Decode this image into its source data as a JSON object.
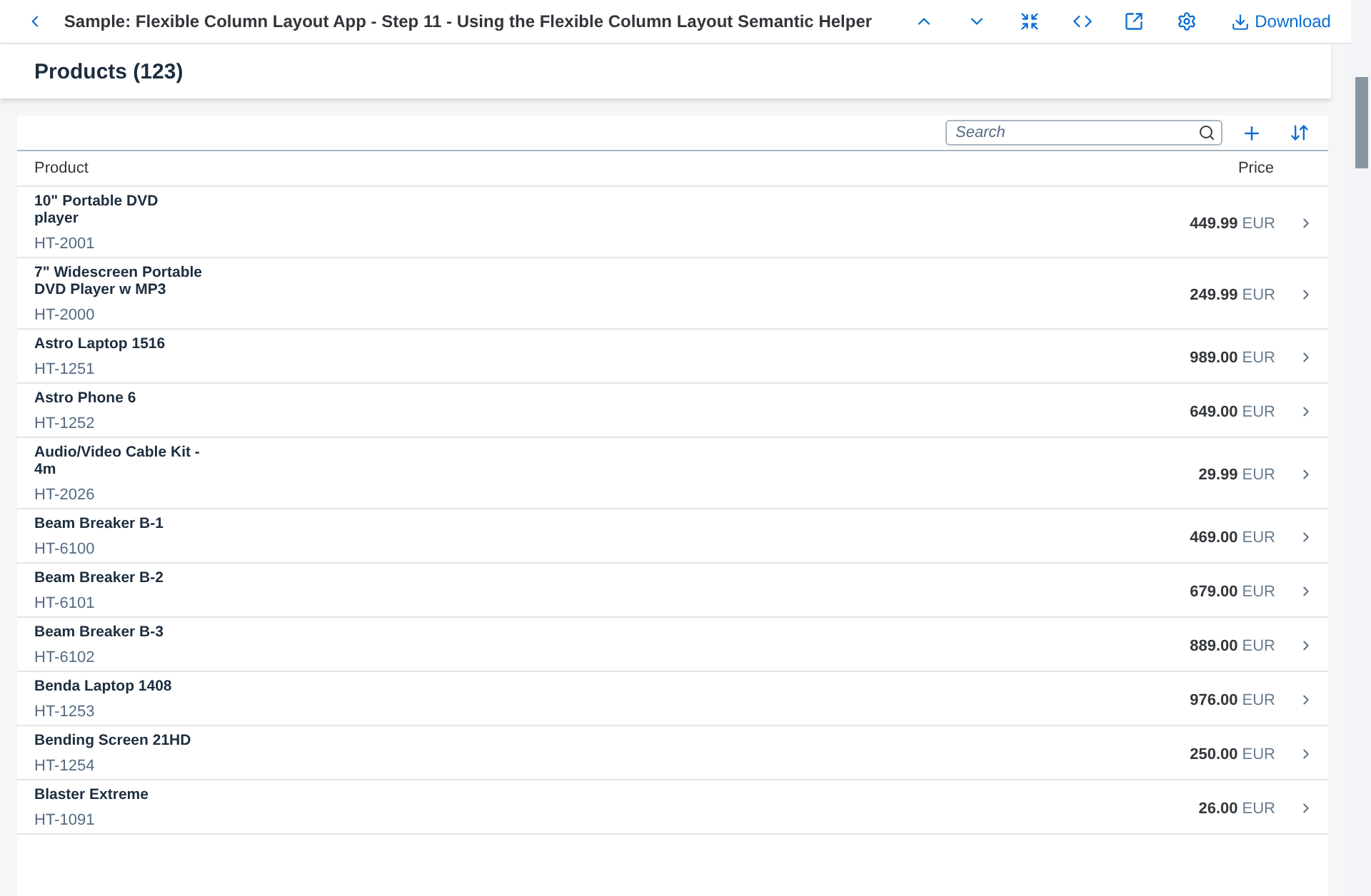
{
  "toolbar": {
    "title": "Sample: Flexible Column Layout App - Step 11 - Using the Flexible Column Layout Semantic Helper",
    "download": "Download"
  },
  "page": {
    "title": "Products (123)"
  },
  "table": {
    "search": {
      "placeholder": "Search"
    },
    "columns": [
      "Product",
      "Price"
    ],
    "rows": [
      {
        "name": "10\" Portable DVD player",
        "id": "HT-2001",
        "price": "449.99",
        "currency": "EUR"
      },
      {
        "name": "7\" Widescreen Portable DVD Player w MP3",
        "id": "HT-2000",
        "price": "249.99",
        "currency": "EUR"
      },
      {
        "name": "Astro Laptop 1516",
        "id": "HT-1251",
        "price": "989.00",
        "currency": "EUR"
      },
      {
        "name": "Astro Phone 6",
        "id": "HT-1252",
        "price": "649.00",
        "currency": "EUR"
      },
      {
        "name": "Audio/Video Cable Kit - 4m",
        "id": "HT-2026",
        "price": "29.99",
        "currency": "EUR"
      },
      {
        "name": "Beam Breaker B-1",
        "id": "HT-6100",
        "price": "469.00",
        "currency": "EUR"
      },
      {
        "name": "Beam Breaker B-2",
        "id": "HT-6101",
        "price": "679.00",
        "currency": "EUR"
      },
      {
        "name": "Beam Breaker B-3",
        "id": "HT-6102",
        "price": "889.00",
        "currency": "EUR"
      },
      {
        "name": "Benda Laptop 1408",
        "id": "HT-1253",
        "price": "976.00",
        "currency": "EUR"
      },
      {
        "name": "Bending Screen 21HD",
        "id": "HT-1254",
        "price": "250.00",
        "currency": "EUR"
      },
      {
        "name": "Blaster Extreme",
        "id": "HT-1091",
        "price": "26.00",
        "currency": "EUR"
      }
    ]
  }
}
